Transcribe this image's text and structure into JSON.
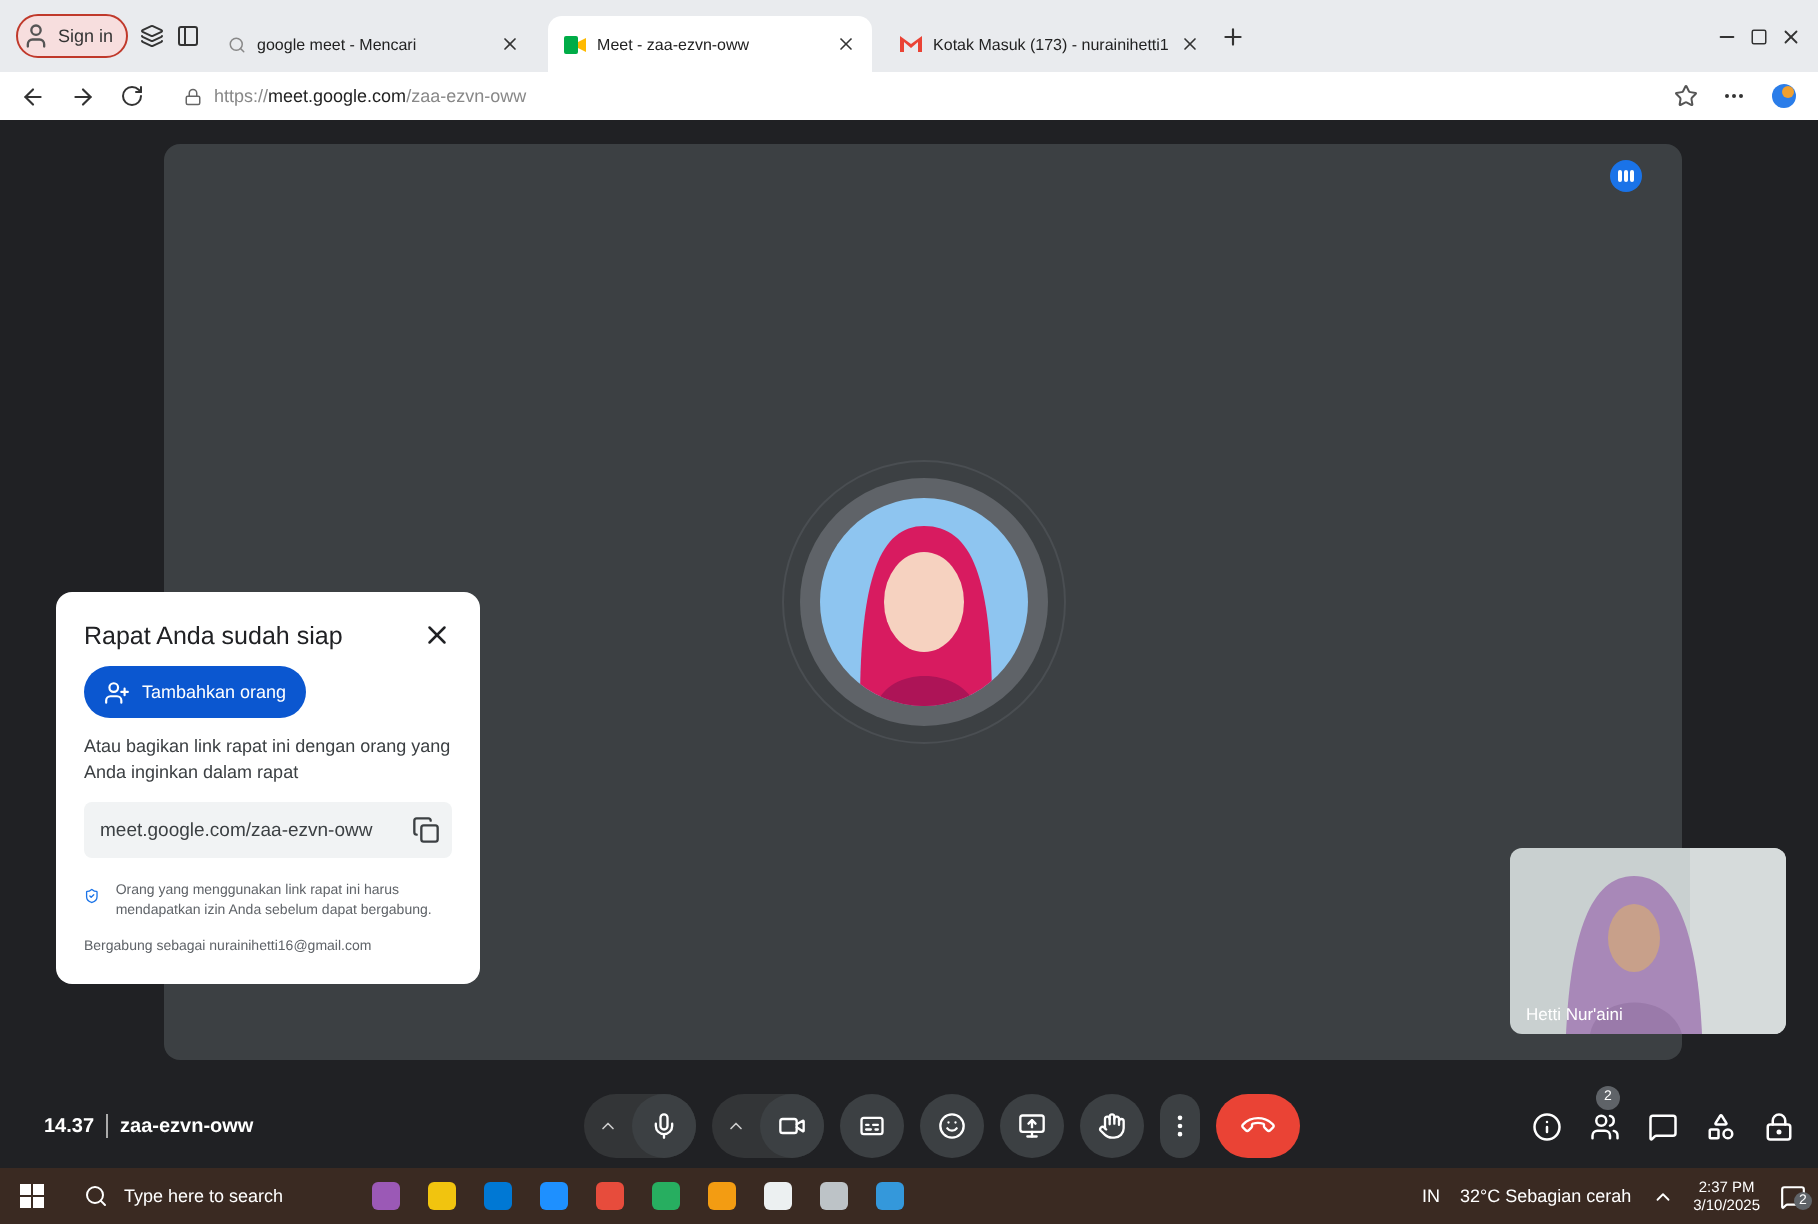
{
  "browser": {
    "sign_in": "Sign in",
    "tabs": [
      {
        "label": "google meet - Mencari",
        "selected": false,
        "kind": "search"
      },
      {
        "label": "Meet - zaa-ezvn-oww",
        "selected": true,
        "kind": "meet"
      },
      {
        "label": "Kotak Masuk (173) - nurainihetti1",
        "selected": false,
        "kind": "mail"
      }
    ],
    "url": {
      "scheme": "https://",
      "host": "meet.google.com",
      "path": "/zaa-ezvn-oww"
    }
  },
  "dialog": {
    "title": "Rapat Anda sudah siap",
    "add_button": "Tambahkan orang",
    "share_text": "Atau bagikan link rapat ini dengan orang yang Anda inginkan dalam rapat",
    "link": "meet.google.com/zaa-ezvn-oww",
    "notice": "Orang yang menggunakan link rapat ini harus mendapatkan izin Anda sebelum dapat bergabung.",
    "joined_as": "Bergabung sebagai nurainihetti16@gmail.com"
  },
  "self_view": {
    "name": "Hetti Nur'aini"
  },
  "bottom_bar": {
    "time": "14.37",
    "meeting_code": "zaa-ezvn-oww",
    "participants_count": "2"
  },
  "taskbar": {
    "search_placeholder": "Type here to search",
    "language": "IN",
    "weather": "32°C Sebagian cerah",
    "time": "2:37 PM",
    "date": "3/10/2025",
    "notification_count": "2"
  }
}
